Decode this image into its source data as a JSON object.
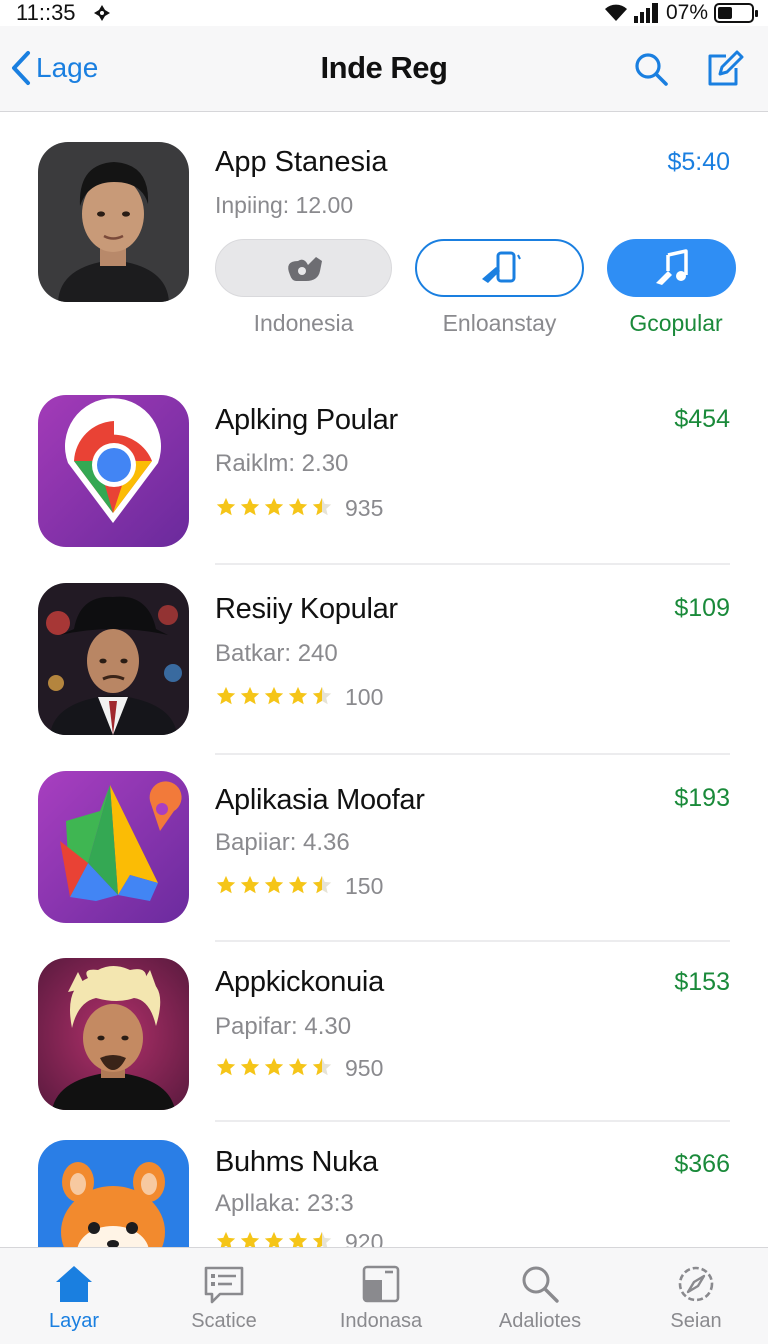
{
  "status_bar": {
    "time": "11::35",
    "battery_text": "07%",
    "icons": [
      "signal-glyph-icon",
      "wifi-icon",
      "cellular-bars-icon",
      "battery-icon"
    ]
  },
  "nav": {
    "back_label": "Lage",
    "title": "Inde Reg",
    "icons": [
      "chevron-left-icon",
      "search-icon",
      "compose-icon"
    ]
  },
  "featured": {
    "name": "App Stanesia",
    "subtitle": "Inpiing: 12.00",
    "price": "$5:40",
    "buttons": [
      {
        "label": "Indonesia",
        "icon": "headphones-icon"
      },
      {
        "label": "Enloanstay",
        "icon": "phone-icon"
      },
      {
        "label": "Gcopular",
        "icon": "music-note-icon"
      }
    ],
    "colors": {
      "accent": "#1a7fe0",
      "green": "#1a8a3a"
    }
  },
  "apps": [
    {
      "name": "Aplking Poular",
      "meta": "Raiklm: 2.30",
      "price": "$454",
      "rating": 4.5,
      "count": "935",
      "icon": "chrome-style-icon"
    },
    {
      "name": "Resiiy Kopular",
      "meta": "Batkar: 240",
      "price": "$109",
      "rating": 4.5,
      "count": "100",
      "icon": "man-in-hat-portrait"
    },
    {
      "name": "Aplikasia Moofar",
      "meta": "Bapiiar: 4.36",
      "price": "$193",
      "rating": 4.5,
      "count": "150",
      "icon": "maps-style-icon"
    },
    {
      "name": "Appkickonuia",
      "meta": "Papifar: 4.30",
      "price": "$153",
      "rating": 4.5,
      "count": "950",
      "icon": "blond-man-portrait"
    },
    {
      "name": "Buhms Nuka",
      "meta": "Apllaka: 23:3",
      "price": "$366",
      "rating": 4.5,
      "count": "920",
      "icon": "fox-mascot-icon"
    }
  ],
  "tabs": [
    {
      "label": "Layar",
      "icon": "home-icon",
      "active": true
    },
    {
      "label": "Scatice",
      "icon": "list-card-icon",
      "active": false
    },
    {
      "label": "Indonasa",
      "icon": "window-icon",
      "active": false
    },
    {
      "label": "Adaliotes",
      "icon": "search-icon",
      "active": false
    },
    {
      "label": "Seian",
      "icon": "compass-icon",
      "active": false
    }
  ]
}
